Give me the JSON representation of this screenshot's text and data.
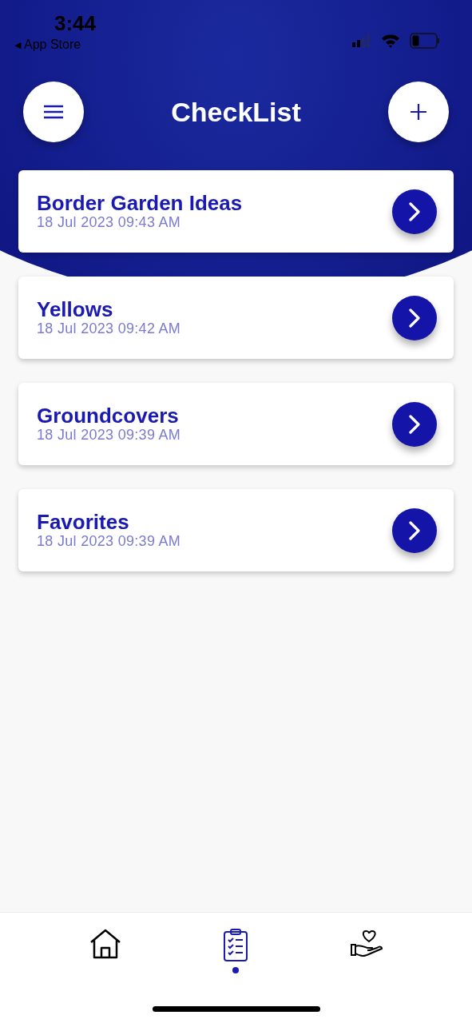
{
  "status_bar": {
    "time": "3:44",
    "back_arrow": "◀",
    "back_label": "App Store"
  },
  "header": {
    "title": "CheckList"
  },
  "lists": [
    {
      "name": "Border Garden Ideas",
      "date": "18 Jul 2023 09:43 AM"
    },
    {
      "name": "Yellows",
      "date": "18 Jul 2023 09:42 AM"
    },
    {
      "name": "Groundcovers",
      "date": "18 Jul 2023 09:39 AM"
    },
    {
      "name": "Favorites",
      "date": "18 Jul 2023 09:39 AM"
    }
  ],
  "tab_bar": [
    {
      "kind": "home",
      "selected": false
    },
    {
      "kind": "checklist",
      "selected": true
    },
    {
      "kind": "care",
      "selected": false
    }
  ]
}
